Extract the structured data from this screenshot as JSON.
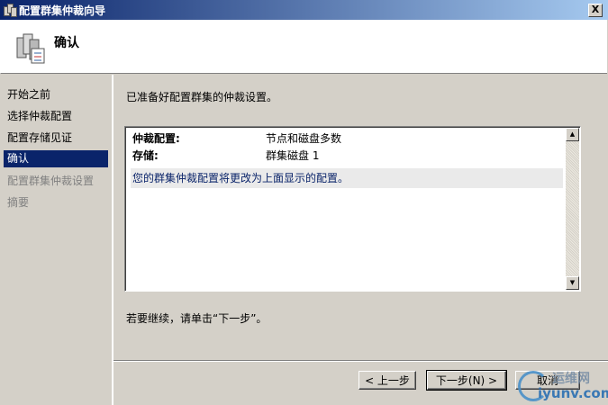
{
  "window": {
    "title": "配置群集仲裁向导",
    "close_label": "X"
  },
  "header": {
    "title": "确认",
    "icon": "cluster-wizard-icon"
  },
  "sidebar": {
    "items": [
      {
        "label": "开始之前",
        "state": "normal"
      },
      {
        "label": "选择仲裁配置",
        "state": "normal"
      },
      {
        "label": "配置存储见证",
        "state": "normal"
      },
      {
        "label": "确认",
        "state": "active"
      },
      {
        "label": "配置群集仲裁设置",
        "state": "disabled"
      },
      {
        "label": "摘要",
        "state": "disabled"
      }
    ]
  },
  "main": {
    "intro": "已准备好配置群集的仲裁设置。",
    "summary": {
      "rows": [
        {
          "key": "仲裁配置:",
          "value": "节点和磁盘多数"
        },
        {
          "key": "存储:",
          "value": "群集磁盘 1"
        }
      ],
      "note": "您的群集仲裁配置将更改为上面显示的配置。"
    },
    "continue_text": "若要继续，请单击“下一步”。"
  },
  "buttons": {
    "back": "< 上一步",
    "next": "下一步(N) >",
    "cancel": "取消"
  },
  "watermark": {
    "line1": "运维网",
    "line2": "iyunv.com"
  },
  "colors": {
    "title_bar": "#0a246a",
    "selected_item": "#0a246a",
    "window_bg": "#d4d0c8"
  }
}
